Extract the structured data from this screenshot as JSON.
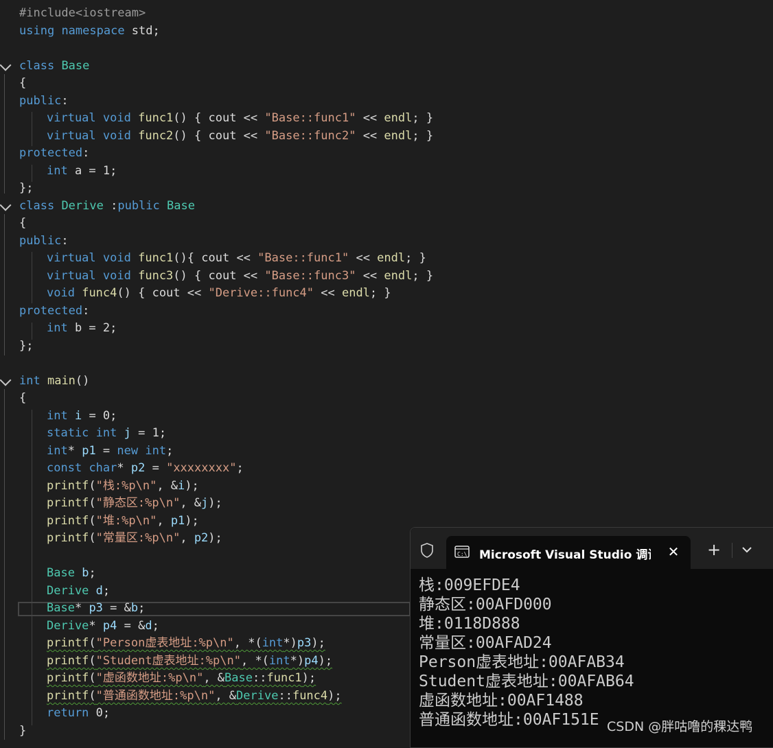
{
  "code": {
    "include": "#include<iostream>",
    "line1": [
      "using",
      " ",
      "namespace",
      " std;"
    ],
    "base_class": [
      "class",
      " ",
      "Base"
    ],
    "brace_open": "{",
    "public": "public",
    "colon": ":",
    "protected": "protected",
    "brace_close_semi": "};",
    "base_func1": [
      "virtual",
      " ",
      "void",
      " ",
      "func1",
      "() { ",
      "cout",
      " << ",
      "\"Base::func1\"",
      " << ",
      "endl",
      "; }"
    ],
    "base_func2": [
      "virtual",
      " ",
      "void",
      " ",
      "func2",
      "() { ",
      "cout",
      " << ",
      "\"Base::func2\"",
      " << ",
      "endl",
      "; }"
    ],
    "int_a": [
      "int",
      " a = 1;"
    ],
    "derive_class": [
      "class",
      " ",
      "Derive",
      " :",
      "public",
      " ",
      "Base"
    ],
    "derive_func1": [
      "virtual",
      " ",
      "void",
      " ",
      "func1",
      "(){ ",
      "cout",
      " << ",
      "\"Base::func1\"",
      " << ",
      "endl",
      "; }"
    ],
    "derive_func3": [
      "virtual",
      " ",
      "void",
      " ",
      "func3",
      "() { ",
      "cout",
      " << ",
      "\"Base::func3\"",
      " << ",
      "endl",
      "; }"
    ],
    "derive_func4": [
      "void",
      " ",
      "func4",
      "() { ",
      "cout",
      " << ",
      "\"Derive::func4\"",
      " << ",
      "endl",
      "; }"
    ],
    "int_b": [
      "int",
      " b = 2;"
    ],
    "main_sig": [
      "int",
      " ",
      "main",
      "()"
    ],
    "m_i": [
      "int",
      " ",
      "i",
      " = 0;"
    ],
    "m_j": [
      "static",
      " ",
      "int",
      " ",
      "j",
      " = 1;"
    ],
    "m_p1": [
      "int",
      "* ",
      "p1",
      " = ",
      "new",
      " ",
      "int",
      ";"
    ],
    "m_p2": [
      "const",
      " ",
      "char",
      "* ",
      "p2",
      " = ",
      "\"xxxxxxxx\"",
      ";"
    ],
    "m_pf1": [
      "printf",
      "(",
      "\"栈:%p\\n\"",
      ", &",
      "i",
      ");"
    ],
    "m_pf2": [
      "printf",
      "(",
      "\"静态区:%p\\n\"",
      ", &",
      "j",
      ");"
    ],
    "m_pf3": [
      "printf",
      "(",
      "\"堆:%p\\n\"",
      ", ",
      "p1",
      ");"
    ],
    "m_pf4": [
      "printf",
      "(",
      "\"常量区:%p\\n\"",
      ", ",
      "p2",
      ");"
    ],
    "m_b": [
      "Base",
      " ",
      "b",
      ";"
    ],
    "m_d": [
      "Derive",
      " ",
      "d",
      ";"
    ],
    "m_p3": [
      "Base",
      "* ",
      "p3",
      " = &",
      "b",
      ";"
    ],
    "m_p4": [
      "Derive",
      "* ",
      "p4",
      " = &",
      "d",
      ";"
    ],
    "m_pf5": [
      "printf",
      "(",
      "\"Person虚表地址:%p\\n\"",
      ", *(",
      "int",
      "*)",
      "p3",
      ");"
    ],
    "m_pf6": [
      "printf",
      "(",
      "\"Student虚表地址:%p\\n\"",
      ", *(",
      "int",
      "*)",
      "p4",
      ");"
    ],
    "m_pf7": [
      "printf",
      "(",
      "\"虚函数地址:%p\\n\"",
      ", &",
      "Base",
      "::",
      "func1",
      ");"
    ],
    "m_pf8": [
      "printf",
      "(",
      "\"普通函数地址:%p\\n\"",
      ", &",
      "Derive",
      "::",
      "func4",
      ");"
    ],
    "m_ret": [
      "return",
      " 0;"
    ],
    "brace_close": "}"
  },
  "terminal": {
    "tab_title": "Microsoft Visual Studio 调试控",
    "close_glyph": "✕",
    "new_tab_glyph": "+",
    "output": "栈:009EFDE4\n静态区:00AFD000\n堆:0118D888\n常量区:00AFAD24\nPerson虚表地址:00AFAB34\nStudent虚表地址:00AFAB64\n虚函数地址:00AF1488\n普通函数地址:00AF151E"
  },
  "watermark": "CSDN @胖咕噜的稞达鸭",
  "icons": [
    "chevron-down-icon",
    "shield-icon",
    "terminal-icon",
    "close-icon",
    "plus-icon"
  ]
}
